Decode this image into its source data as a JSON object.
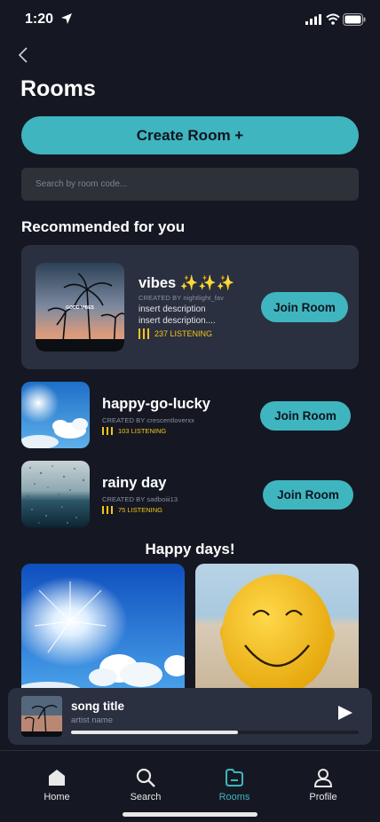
{
  "status": {
    "time": "1:20"
  },
  "header": {
    "title": "Rooms",
    "create_label": "Create Room +"
  },
  "search": {
    "placeholder": "Search by room code..."
  },
  "recommended": {
    "title": "Recommended for you",
    "thumb_text": "GOOD VIBES",
    "rooms": [
      {
        "name": "vibes ✨✨✨",
        "creator": "CREATED BY nightlight_fav",
        "desc1": "insert description",
        "desc2": "insert description....",
        "listening": "237 LISTENING",
        "join": "Join Room"
      },
      {
        "name": "happy-go-lucky",
        "creator": "CREATED BY crescentloverxx",
        "listening": "103 LISTENING",
        "join": "Join Room"
      },
      {
        "name": "rainy day",
        "creator": "CREATED BY sadboiii13",
        "listening": "75 LISTENING",
        "join": "Join Room"
      }
    ]
  },
  "happy": {
    "title": "Happy days!"
  },
  "player": {
    "title": "song title",
    "artist": "artist name",
    "progress": 0.58
  },
  "tabs": [
    {
      "label": "Home",
      "icon": "home-icon"
    },
    {
      "label": "Search",
      "icon": "search-icon"
    },
    {
      "label": "Rooms",
      "icon": "rooms-icon"
    },
    {
      "label": "Profile",
      "icon": "profile-icon"
    }
  ],
  "colors": {
    "accent": "#3fb5bf",
    "background": "#151823",
    "card": "#2b3040",
    "listening": "#f5c518"
  }
}
